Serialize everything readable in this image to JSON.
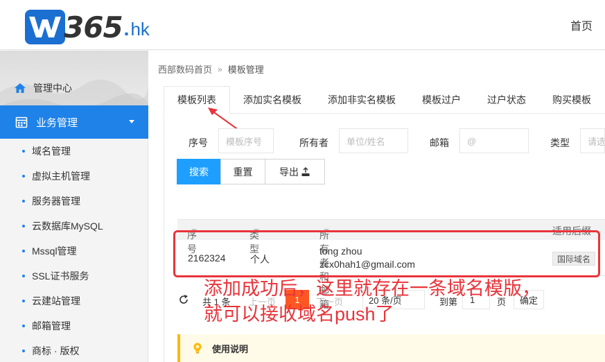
{
  "brand": {
    "logo_number": "365",
    "logo_dot": ".",
    "logo_suffix": "hk"
  },
  "header": {
    "home_link": "首页"
  },
  "sidebar": {
    "mgmt_center": "管理中心",
    "active_section": "业务管理",
    "items": [
      {
        "label": "域名管理"
      },
      {
        "label": "虚拟主机管理"
      },
      {
        "label": "服务器管理"
      },
      {
        "label": "云数据库MySQL"
      },
      {
        "label": "Mssql管理"
      },
      {
        "label": "SSL证书服务"
      },
      {
        "label": "云建站管理"
      },
      {
        "label": "邮箱管理"
      },
      {
        "label": "商标 · 版权"
      }
    ]
  },
  "breadcrumb": {
    "root": "西部数码首页",
    "separator": "»",
    "current": "模板管理"
  },
  "tabs": [
    {
      "label": "模板列表",
      "active": true
    },
    {
      "label": "添加实名模板"
    },
    {
      "label": "添加非实名模板"
    },
    {
      "label": "模板过户"
    },
    {
      "label": "过户状态"
    },
    {
      "label": "购买模板"
    }
  ],
  "search": {
    "id_label": "序号",
    "id_placeholder": "模板序号",
    "owner_label": "所有者",
    "owner_placeholder": "单位/姓名",
    "email_label": "邮箱",
    "email_placeholder": "@",
    "type_label": "类型",
    "type_placeholder": "请选"
  },
  "buttons": {
    "search": "搜索",
    "reset": "重置",
    "export": "导出"
  },
  "table": {
    "headers": {
      "id": "序号",
      "type": "类型",
      "owner": "所有者和邮箱",
      "suffix": "适用后缀"
    },
    "rows": [
      {
        "id": "2162324",
        "type": "个人",
        "owner": "tong zhou",
        "email": "zcx0hah1@gmail.com",
        "suffix": "国际域名"
      }
    ]
  },
  "pager": {
    "total": "共 1 条",
    "prev": "上一页",
    "current_page": "1",
    "next": "下一页",
    "per_page": "20 条/页",
    "goto_prefix": "到第",
    "goto_value": "1",
    "goto_suffix": "页",
    "confirm": "确定"
  },
  "annotation": {
    "line1": "添加成功后，这里就存在一条域名模版，",
    "line2": "就可以接收域名push了",
    "color": "#e8343a"
  },
  "notice": {
    "title": "使用说明"
  },
  "colors": {
    "primary": "#1e82e8",
    "search_button": "#1e9fff",
    "current_page": "#ff5722",
    "notice_border": "#ffb800"
  }
}
